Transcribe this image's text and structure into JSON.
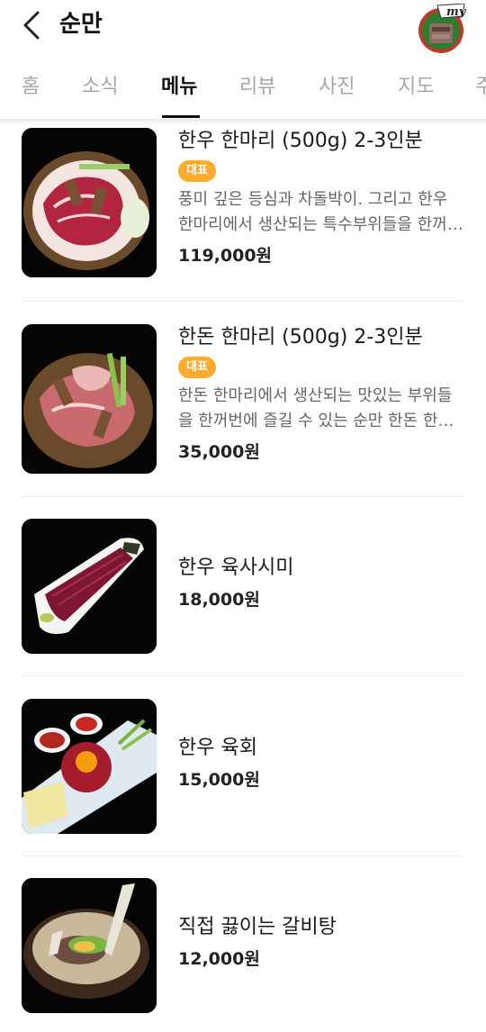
{
  "header": {
    "title": "순만",
    "back_icon": "chevron-left-icon",
    "avatar_badge": "my"
  },
  "tabs": [
    {
      "label": "홈",
      "active": false
    },
    {
      "label": "소식",
      "active": false
    },
    {
      "label": "메뉴",
      "active": true
    },
    {
      "label": "리뷰",
      "active": false
    },
    {
      "label": "사진",
      "active": false
    },
    {
      "label": "지도",
      "active": false
    },
    {
      "label": "주",
      "active": false
    }
  ],
  "menu": {
    "items": [
      {
        "name": "한우 한마리 (500g) 2-3인분",
        "badge": "대표",
        "description": "풍미 깊은 등심과 차돌박이. 그리고 한우 한마리에서 생산되는 특수부위들을 한꺼번에",
        "price": "119,000원"
      },
      {
        "name": "한돈 한마리 (500g) 2-3인분",
        "badge": "대표",
        "description": "한돈 한마리에서 생산되는 맛있는 부위들을 한꺼번에 즐길 수 있는 순만 한돈 한마리",
        "price": "35,000원"
      },
      {
        "name": "한우 육사시미",
        "price": "18,000원"
      },
      {
        "name": "한우 육회",
        "price": "15,000원"
      },
      {
        "name": "직접 끓이는 갈비탕",
        "price": "12,000원"
      }
    ]
  },
  "colors": {
    "badge_bg": "#ffab2e",
    "active_tab": "#111111",
    "inactive_tab": "#a6a6a6"
  }
}
